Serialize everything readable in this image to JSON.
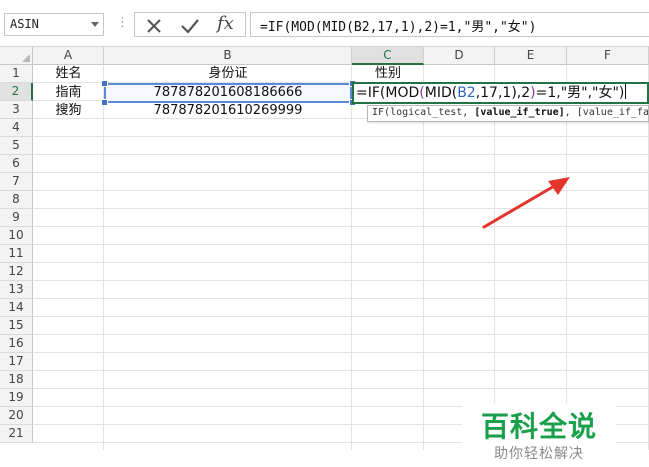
{
  "formula_bar": {
    "name_box": "ASIN",
    "separator": "⋮",
    "formula": "=IF(MOD(MID(B2,17,1),2)=1,\"男\",\"女\")",
    "cancel_icon": "x-icon",
    "enter_icon": "check-icon",
    "fx_label": "fx"
  },
  "columns": [
    {
      "letter": "A"
    },
    {
      "letter": "B"
    },
    {
      "letter": "C"
    },
    {
      "letter": "D"
    },
    {
      "letter": "E"
    },
    {
      "letter": "F"
    }
  ],
  "rows": [
    "1",
    "2",
    "3",
    "4",
    "5",
    "6",
    "7",
    "8",
    "9",
    "10",
    "11",
    "12",
    "13",
    "14",
    "15",
    "16",
    "17",
    "18",
    "19",
    "20",
    "21"
  ],
  "cells": {
    "A1": "姓名",
    "B1": "身份证",
    "C1": "性别",
    "A2": "指南",
    "B2": "787878201608186666",
    "A3": "搜狗",
    "B3": "787878201610269999"
  },
  "editing_cell": {
    "address": "C2",
    "parts": {
      "p1": "=IF(MOD",
      "p2": "(",
      "p3": "MID(",
      "p4": "B2",
      "p5": ",17,1)",
      "p6": ",2",
      "p7": ")",
      "p8": "=1,\"男\",\"女\")"
    }
  },
  "tooltip": {
    "fn": "IF(",
    "arg1": "logical_test, ",
    "arg2": "[value_if_true]",
    "arg3": ", [value_if_false])"
  },
  "watermark": {
    "title": "百科全说",
    "subtitle": "助你轻松解决"
  },
  "colors": {
    "accent_green": "#217346",
    "arrow_red": "#e5342e",
    "watermark_green": "#1aa04a"
  }
}
